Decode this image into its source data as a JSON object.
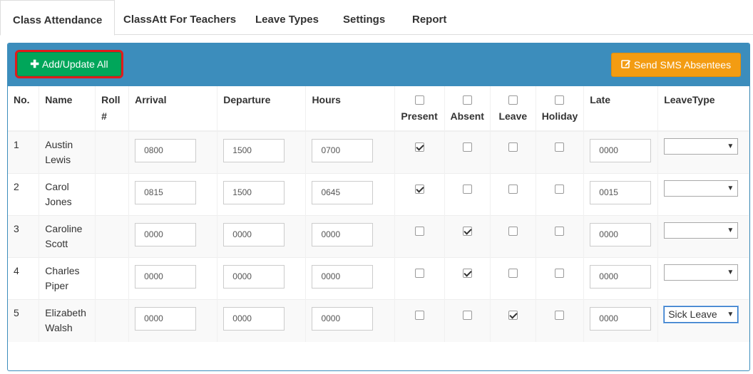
{
  "tabs": [
    {
      "label": "Class Attendance"
    },
    {
      "label": "ClassAtt For Teachers"
    },
    {
      "label": "Leave Types"
    },
    {
      "label": "Settings"
    },
    {
      "label": "Report"
    }
  ],
  "toolbar": {
    "add_label": "Add/Update All",
    "sms_label": "Send SMS Absentees"
  },
  "columns": {
    "no": "No.",
    "name": "Name",
    "roll": "Roll #",
    "arrival": "Arrival",
    "departure": "Departure",
    "hours": "Hours",
    "present": "Present",
    "absent": "Absent",
    "leave": "Leave",
    "holiday": "Holiday",
    "late": "Late",
    "leavetype": "LeaveType"
  },
  "rows": [
    {
      "no": "1",
      "first": "Austin",
      "last": "Lewis",
      "arrival": "0800",
      "departure": "1500",
      "hours": "0700",
      "late": "0000",
      "leavetype": ""
    },
    {
      "no": "2",
      "first": "Carol",
      "last": "Jones",
      "arrival": "0815",
      "departure": "1500",
      "hours": "0645",
      "late": "0015",
      "leavetype": ""
    },
    {
      "no": "3",
      "first": "Caroline",
      "last": "Scott",
      "arrival": "0000",
      "departure": "0000",
      "hours": "0000",
      "late": "0000",
      "leavetype": ""
    },
    {
      "no": "4",
      "first": "Charles",
      "last": "Piper",
      "arrival": "0000",
      "departure": "0000",
      "hours": "0000",
      "late": "0000",
      "leavetype": ""
    },
    {
      "no": "5",
      "first": "Elizabeth",
      "last": "Walsh",
      "arrival": "0000",
      "departure": "0000",
      "hours": "0000",
      "late": "0000",
      "leavetype": "Sick Leave"
    }
  ],
  "checks": [
    {
      "present": true,
      "absent": false,
      "leave": false,
      "holiday": false
    },
    {
      "present": true,
      "absent": false,
      "leave": false,
      "holiday": false
    },
    {
      "present": false,
      "absent": true,
      "leave": false,
      "holiday": false
    },
    {
      "present": false,
      "absent": true,
      "leave": false,
      "holiday": false
    },
    {
      "present": false,
      "absent": false,
      "leave": true,
      "holiday": false
    }
  ],
  "colors": {
    "header": "#3c8dbc",
    "add_button": "#00a65a",
    "sms_button": "#f39c12",
    "highlight": "#e01b1b"
  },
  "icons": {
    "add": "plus-icon",
    "sms": "edit-icon",
    "select": "caret-down-icon"
  }
}
